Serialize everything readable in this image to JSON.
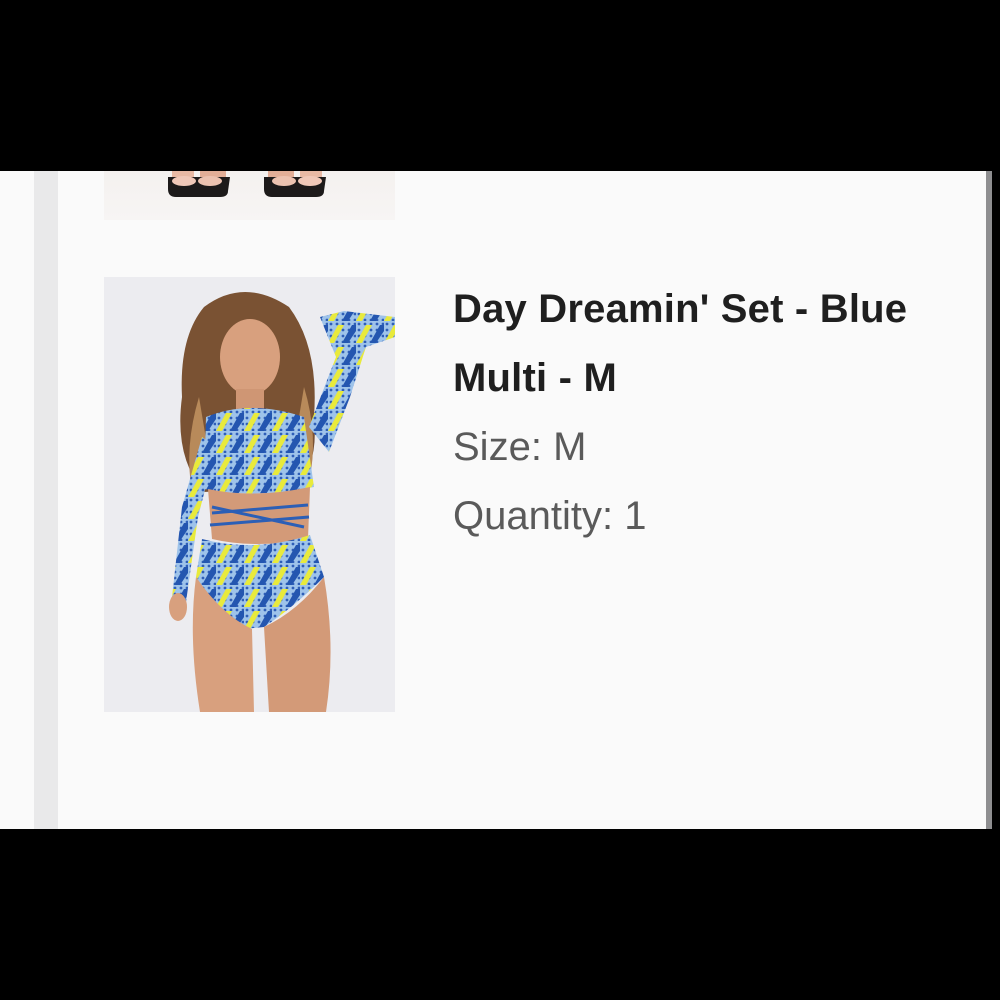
{
  "item": {
    "title": "Day Dreamin' Set - Blue Multi - M",
    "size_label": "Size:",
    "size_value": "M",
    "quantity_label": "Quantity:",
    "quantity_value": "1",
    "image_icon": "product-photo"
  },
  "previous_item": {
    "image_icon": "product-photo-sandals"
  },
  "colors": {
    "title": "#1f1f1f",
    "meta": "#5a5a5a",
    "background": "#fafafa"
  }
}
